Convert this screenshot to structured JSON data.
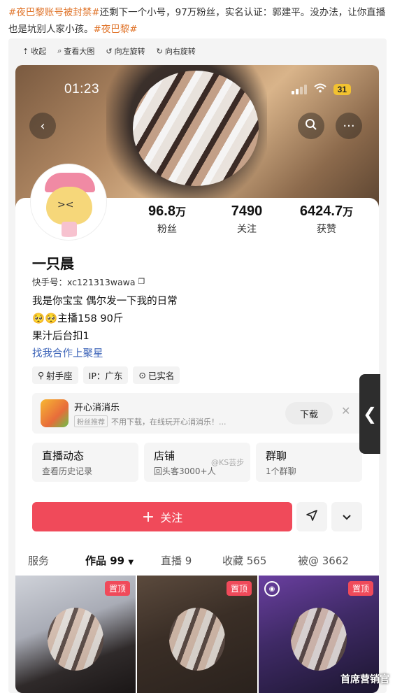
{
  "post": {
    "tag1": "#夜巴黎账号被封禁#",
    "text": "还剩下一个小号，97万粉丝，实名认证：郭建平。没办法，让你直播也是坑别人家小孩。",
    "tag2": "#夜巴黎#"
  },
  "toolbar": {
    "collapse": "收起",
    "view_large": "查看大图",
    "rotate_left": "向左旋转",
    "rotate_right": "向右旋转"
  },
  "status": {
    "time": "01:23",
    "battery": "31"
  },
  "profile": {
    "stats": [
      {
        "num": "96.8",
        "unit": "万",
        "label": "粉丝"
      },
      {
        "num": "7490",
        "unit": "",
        "label": "关注"
      },
      {
        "num": "6424.7",
        "unit": "万",
        "label": "获赞"
      }
    ],
    "name": "一只晨",
    "id_label": "快手号：xc121313wawa",
    "bio_line1": "我是你宝宝  偶尔发一下我的日常",
    "bio_line2": "🥺🥺主播158 90斤",
    "bio_line3": "果汁后台扣1",
    "bio_link": "找我合作上聚星",
    "tags": [
      "射手座",
      "IP：广东",
      "已实名"
    ]
  },
  "ad": {
    "title": "开心消消乐",
    "badge": "粉丝推荐",
    "subtitle": "不用下载，在线玩开心消消乐！...",
    "download": "下载"
  },
  "features": [
    {
      "title": "直播动态",
      "sub": "查看历史记录"
    },
    {
      "title": "店铺",
      "sub": "回头客3000+人"
    },
    {
      "title": "群聊",
      "sub": "1个群聊"
    }
  ],
  "watermark": "@KS芸步",
  "follow_label": "关注",
  "tabs": [
    {
      "label": "服务"
    },
    {
      "label": "作品 99"
    },
    {
      "label": "直播 9"
    },
    {
      "label": "收藏 565"
    },
    {
      "label": "被@ 3662"
    }
  ],
  "pin_label": "置顶",
  "corner_watermark": "首席营销官"
}
